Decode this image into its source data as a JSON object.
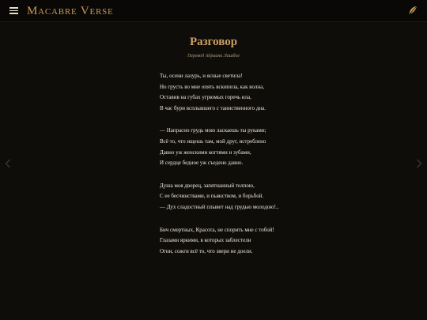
{
  "header": {
    "brand": "Macabre Verse",
    "menu_icon": "hamburger-menu-icon",
    "action_icon": "feather-quill-icon"
  },
  "colors": {
    "accent": "#c99a54",
    "background": "#0f0d0a",
    "topbar": "#090806",
    "text": "#eee8dc"
  },
  "poem": {
    "title": "Разговор",
    "subtitle": "Перевод Адриана Лашбое",
    "stanzas": [
      [
        "Ты, осени лазурь, и ясные светила!",
        "Но грусть во мне опять вскипела, как волна,",
        "Оставив на губах угрюмых горечь ила,",
        "В час бури всплывшего с таинственного дна."
      ],
      [
        "— Напрасно грудь мою ласкаешь ты руками;",
        "Всё то, что ищешь там, мой друг, истреблено",
        "Давно уж женскими когтями и зубами,",
        "И сердце бедное уж съедено давно."
      ],
      [
        "Душа моя дворец, запятнанный толпою,",
        "С ее бесчинствами, и пьянством, и борьбой.",
        "— Дух сладостный плывет над грудью молодою!.."
      ],
      [
        "Бич смертных, Красота, не спорить мне с тобой!",
        "Глазами яркими, в которых заблестели",
        "Огни, сожги всё то, что звери не доели."
      ]
    ]
  },
  "navigation": {
    "prev_icon": "chevron-left-icon",
    "next_icon": "chevron-right-icon"
  }
}
